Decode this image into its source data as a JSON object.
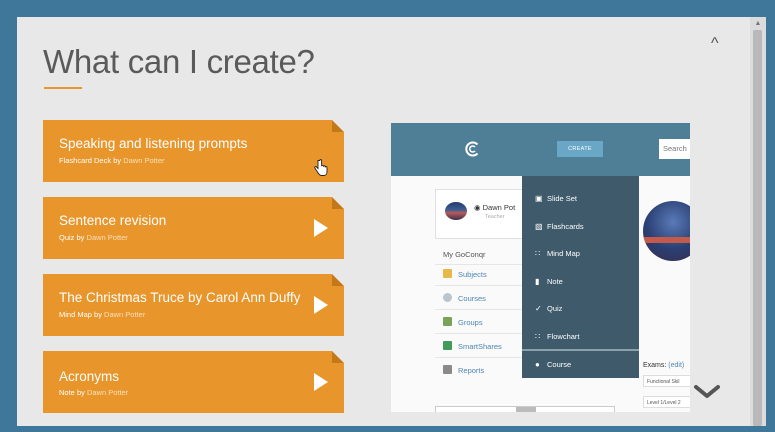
{
  "page": {
    "title": "What can I create?",
    "collapse_icon": "chevron-up-icon",
    "scroll_down_icon": "chevron-down-icon"
  },
  "cards": [
    {
      "title": "Speaking and listening prompts",
      "type": "Flashcard Deck",
      "by": "by",
      "author": "Dawn Potter"
    },
    {
      "title": "Sentence revision",
      "type": "Quiz",
      "by": "by",
      "author": "Dawn Potter"
    },
    {
      "title": "The Christmas Truce by Carol Ann Duffy",
      "type": "Mind Map",
      "by": "by",
      "author": "Dawn Potter"
    },
    {
      "title": "Acronyms",
      "type": "Note",
      "by": "by",
      "author": "Dawn Potter"
    }
  ],
  "screenshot": {
    "create_label": "CREATE",
    "search_placeholder": "Search",
    "profile_name": "Dawn Pot",
    "profile_role": "Teacher",
    "nav_heading": "My GoConqr",
    "nav_items": [
      "Subjects",
      "Courses",
      "Groups",
      "SmartShares",
      "Reports"
    ],
    "exams_label": "Exams:",
    "exams_edit": "(edit)",
    "exam_cells": [
      "Functional Skil",
      "Level 1/Level 2"
    ],
    "menu": [
      {
        "label": "Slide Set",
        "icon": "slides-icon"
      },
      {
        "label": "Flashcards",
        "icon": "flashcards-icon"
      },
      {
        "label": "Mind Map",
        "icon": "mindmap-icon"
      },
      {
        "label": "Note",
        "icon": "note-icon"
      },
      {
        "label": "Quiz",
        "icon": "check-icon"
      },
      {
        "label": "Flowchart",
        "icon": "flowchart-icon"
      },
      {
        "label": "Course",
        "icon": "course-icon"
      }
    ]
  },
  "colors": {
    "frame": "#3e7799",
    "card": "#e8952b",
    "panel": "#e8e8e8",
    "menu": "#3e5a6b",
    "header": "#4f7e97"
  }
}
